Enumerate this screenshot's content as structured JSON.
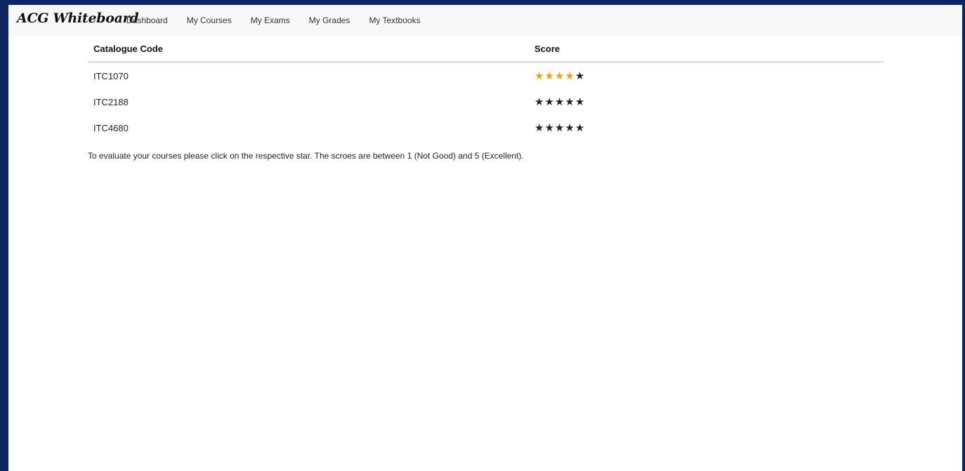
{
  "brand": {
    "title": "ACG Whiteboard"
  },
  "nav": {
    "items": [
      {
        "label": "Dashboard"
      },
      {
        "label": "My Courses"
      },
      {
        "label": "My Exams"
      },
      {
        "label": "My Grades"
      },
      {
        "label": "My Textbooks"
      }
    ]
  },
  "table": {
    "headers": {
      "code": "Catalogue Code",
      "score": "Score"
    },
    "rows": [
      {
        "code": "ITC1070",
        "rating": 4,
        "max": 5
      },
      {
        "code": "ITC2188",
        "rating": 0,
        "max": 5
      },
      {
        "code": "ITC4680",
        "rating": 0,
        "max": 5
      }
    ]
  },
  "note": "To evaluate your courses please click on the respective star. The scroes are between 1 (Not Good) and 5 (Excellent).",
  "colors": {
    "star_filled": "#f5a000",
    "star_empty": "#222222",
    "page_border": "#0f2760"
  },
  "icons": {
    "star": "star-icon"
  }
}
